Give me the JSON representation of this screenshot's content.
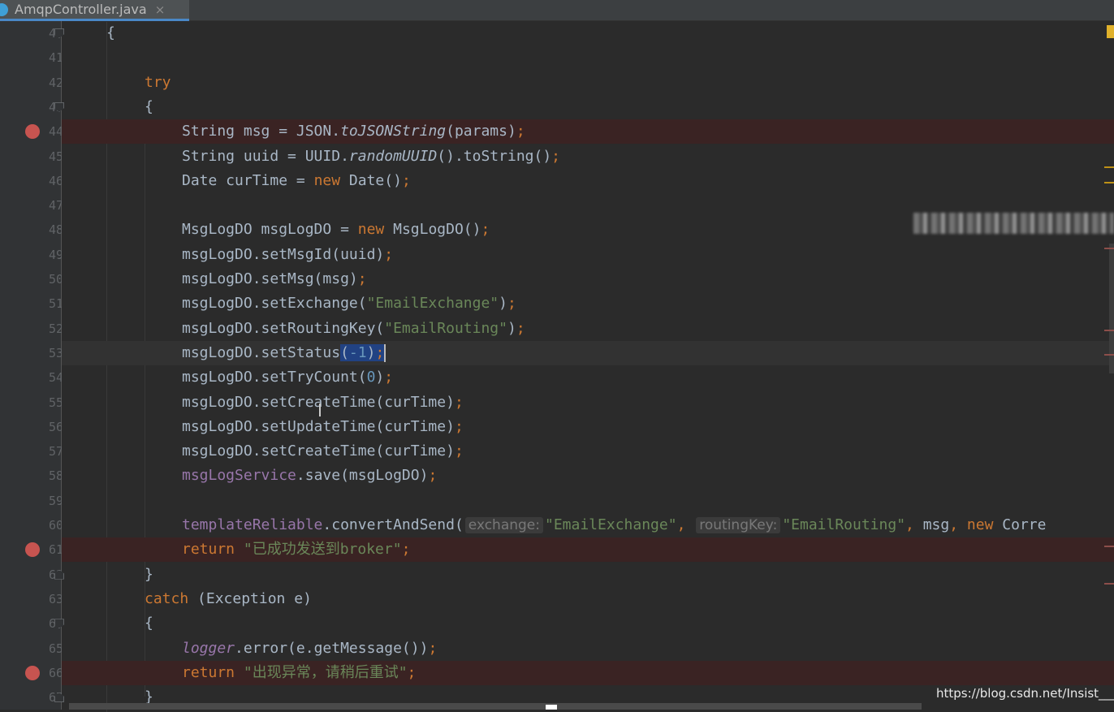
{
  "tab": {
    "file_name": "AmqpController.java",
    "close_glyph": "×"
  },
  "lines": [
    {
      "num": "40",
      "segments": [
        [
          "{",
          "plain"
        ]
      ]
    },
    {
      "num": "41",
      "segments": []
    },
    {
      "num": "42",
      "segments": [
        [
          "try",
          "kw"
        ]
      ]
    },
    {
      "num": "43",
      "segments": [
        [
          "{",
          "plain"
        ]
      ]
    },
    {
      "num": "44",
      "segments": [
        [
          "String msg = JSON.",
          "plain"
        ],
        [
          "toJSONString",
          "ital"
        ],
        [
          "(params)",
          "plain"
        ],
        [
          ";",
          "kw"
        ]
      ]
    },
    {
      "num": "45",
      "segments": [
        [
          "String uuid = UUID.",
          "plain"
        ],
        [
          "randomUUID",
          "ital"
        ],
        [
          "().toString()",
          "plain"
        ],
        [
          ";",
          "kw"
        ]
      ]
    },
    {
      "num": "46",
      "segments": [
        [
          "Date curTime = ",
          "plain"
        ],
        [
          "new",
          "kw"
        ],
        [
          " Date()",
          "plain"
        ],
        [
          ";",
          "kw"
        ]
      ]
    },
    {
      "num": "47",
      "segments": []
    },
    {
      "num": "48",
      "segments": [
        [
          "MsgLogDO msgLogDO = ",
          "plain"
        ],
        [
          "new",
          "kw"
        ],
        [
          " MsgLogDO()",
          "plain"
        ],
        [
          ";",
          "kw"
        ]
      ]
    },
    {
      "num": "49",
      "segments": [
        [
          "msgLogDO.setMsgId(uuid)",
          "plain"
        ],
        [
          ";",
          "kw"
        ]
      ]
    },
    {
      "num": "50",
      "segments": [
        [
          "msgLogDO.setMsg(msg)",
          "plain"
        ],
        [
          ";",
          "kw"
        ]
      ]
    },
    {
      "num": "51",
      "segments": [
        [
          "msgLogDO.setExchange(",
          "plain"
        ],
        [
          "\"EmailExchange\"",
          "str"
        ],
        [
          ")",
          "plain"
        ],
        [
          ";",
          "kw"
        ]
      ]
    },
    {
      "num": "52",
      "segments": [
        [
          "msgLogDO.setRoutingKey(",
          "plain"
        ],
        [
          "\"EmailRouting\"",
          "str"
        ],
        [
          ")",
          "plain"
        ],
        [
          ";",
          "kw"
        ]
      ]
    },
    {
      "num": "53",
      "segments": [
        [
          "msgLogDO.setStatus",
          "plain"
        ],
        [
          "(",
          "sel-plain"
        ],
        [
          "-1",
          "sel-num"
        ],
        [
          ")",
          "sel-plain"
        ],
        [
          ";",
          "sel-kw"
        ],
        [
          "",
          "caret"
        ]
      ]
    },
    {
      "num": "54",
      "segments": [
        [
          "msgLogDO.setTryCount(",
          "plain"
        ],
        [
          "0",
          "num"
        ],
        [
          ")",
          "plain"
        ],
        [
          ";",
          "kw"
        ]
      ]
    },
    {
      "num": "55",
      "segments": [
        [
          "msgLogDO.setCreateTime(curTime)",
          "plain"
        ],
        [
          ";",
          "kw"
        ]
      ]
    },
    {
      "num": "56",
      "segments": [
        [
          "msgLogDO.setUpdateTime(curTime)",
          "plain"
        ],
        [
          ";",
          "kw"
        ]
      ]
    },
    {
      "num": "57",
      "segments": [
        [
          "msgLogDO.setCreateTime(curTime)",
          "plain"
        ],
        [
          ";",
          "kw"
        ]
      ]
    },
    {
      "num": "58",
      "segments": [
        [
          "msgLogService",
          "field"
        ],
        [
          ".save(msgLogDO)",
          "plain"
        ],
        [
          ";",
          "kw"
        ]
      ]
    },
    {
      "num": "59",
      "segments": []
    },
    {
      "num": "60",
      "segments": [
        [
          "templateReliable",
          "field"
        ],
        [
          ".convertAndSend(",
          "plain"
        ],
        [
          "exchange:",
          "hint"
        ],
        [
          "\"EmailExchange\"",
          "str"
        ],
        [
          ", ",
          "kw"
        ],
        [
          "routingKey:",
          "hint"
        ],
        [
          "\"EmailRouting\"",
          "str"
        ],
        [
          ", ",
          "kw"
        ],
        [
          "msg",
          "plain"
        ],
        [
          ", ",
          "kw"
        ],
        [
          "new",
          "kw"
        ],
        [
          " Corre",
          "plain"
        ]
      ]
    },
    {
      "num": "61",
      "segments": [
        [
          "return ",
          "kw"
        ],
        [
          "\"已成功发送到broker\"",
          "str"
        ],
        [
          ";",
          "kw"
        ]
      ]
    },
    {
      "num": "62",
      "segments": [
        [
          "}",
          "plain"
        ]
      ]
    },
    {
      "num": "63",
      "segments": [
        [
          "catch",
          "kw"
        ],
        [
          " (Exception e)",
          "plain"
        ]
      ]
    },
    {
      "num": "64",
      "segments": [
        [
          "{",
          "plain"
        ]
      ]
    },
    {
      "num": "65",
      "segments": [
        [
          "logger",
          "ital-field"
        ],
        [
          ".error(e.getMessage())",
          "plain"
        ],
        [
          ";",
          "kw"
        ]
      ]
    },
    {
      "num": "66",
      "segments": [
        [
          "return ",
          "kw"
        ],
        [
          "\"出现异常，请稍后重试\"",
          "str"
        ],
        [
          ";",
          "kw"
        ]
      ]
    },
    {
      "num": "67",
      "segments": [
        [
          "}",
          "plain"
        ]
      ]
    }
  ],
  "breakpoint_lines": [
    "44",
    "61",
    "66"
  ],
  "current_line": "53",
  "watermark": "https://blog.csdn.net/Insist___",
  "colors": {
    "keyword": "#cc7832",
    "string": "#6a8759",
    "number": "#6897bb",
    "field": "#9876aa",
    "breakpoint": "#c75450",
    "selection": "#214283"
  },
  "icons": [
    "java-class-icon",
    "close-icon",
    "breakpoint-icon",
    "fold-icon",
    "warning-marker-icon",
    "text-cursor-icon"
  ]
}
